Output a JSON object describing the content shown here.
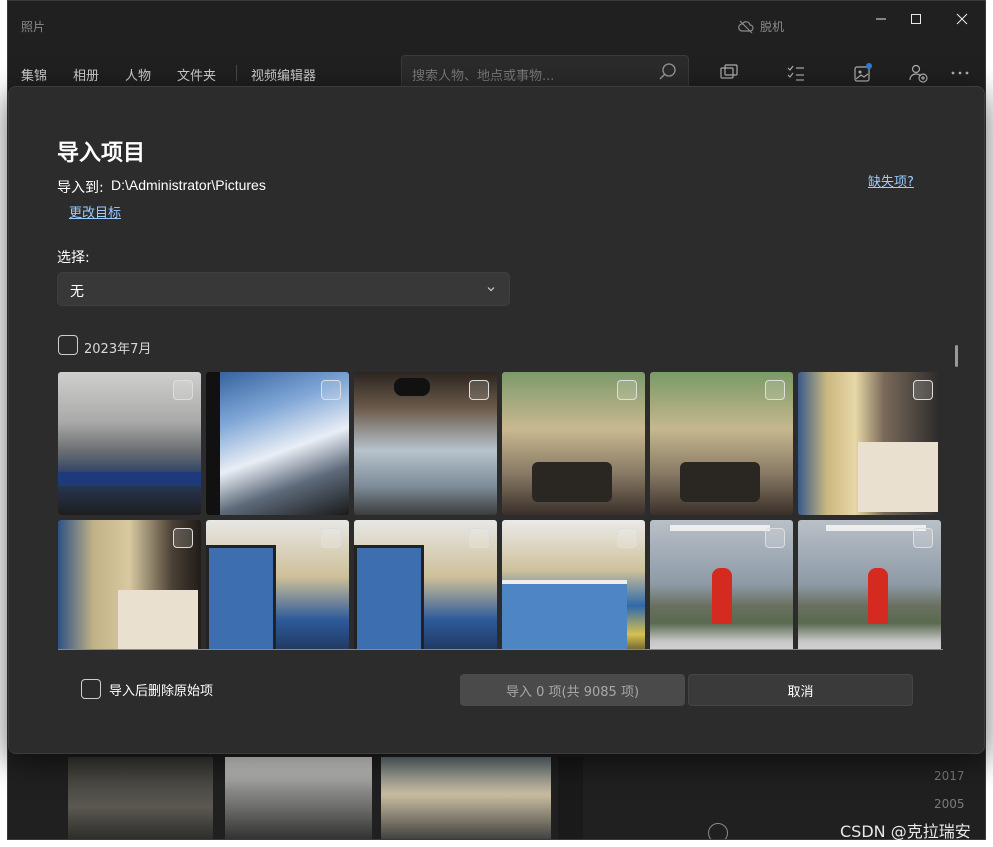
{
  "app": {
    "title": "照片",
    "offline_status": "脱机",
    "window_controls": [
      "minimize-icon",
      "maximize-icon",
      "close-icon"
    ]
  },
  "nav": {
    "items": [
      "集锦",
      "相册",
      "人物",
      "文件夹",
      "视频编辑器"
    ],
    "search_placeholder": "搜索人物、地点或事物..."
  },
  "toolbar_icons": [
    "slideshow-icon",
    "select-icon",
    "import-icon",
    "add-person-icon",
    "more-icon"
  ],
  "background": {
    "years": [
      "2017",
      "2005"
    ]
  },
  "dialog": {
    "title": "导入项目",
    "destination_label": "导入到:",
    "destination_path": "D:\\Administrator\\Pictures",
    "change_target": "更改目标",
    "missing_items": "缺失项?",
    "select_label": "选择:",
    "select_value": "无",
    "group_label": "2023年7月",
    "thumbnails": [
      {
        "scene": "rainy-window-laptop"
      },
      {
        "scene": "sky-building"
      },
      {
        "scene": "desk-gamepad"
      },
      {
        "scene": "tree-building-brushes"
      },
      {
        "scene": "tree-building-brushes-2"
      },
      {
        "scene": "books-window"
      },
      {
        "scene": "books-window-2"
      },
      {
        "scene": "monitor-building"
      },
      {
        "scene": "monitor-building-2"
      },
      {
        "scene": "monitor-screen"
      },
      {
        "scene": "red-dress-lake"
      },
      {
        "scene": "red-dress-lake-2"
      }
    ],
    "delete_after_import": "导入后删除原始项",
    "import_button": "导入 0 项(共 9085 项)",
    "cancel_button": "取消"
  },
  "watermark": "CSDN @克拉瑞安",
  "colors": {
    "link": "#99ccff",
    "dialog_bg": "#2c2c2c",
    "app_bg": "#202020"
  }
}
